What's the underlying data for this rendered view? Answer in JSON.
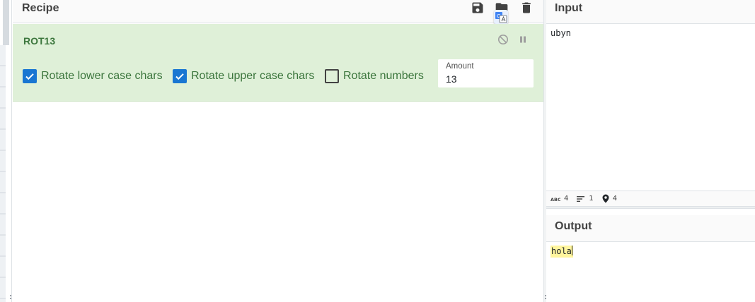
{
  "recipe": {
    "title": "Recipe",
    "icons": [
      "save-icon",
      "folder-open-icon",
      "trash-icon"
    ]
  },
  "operation": {
    "name": "ROT13",
    "controls": [
      "disable-icon",
      "pause-icon"
    ],
    "options": [
      {
        "label": "Rotate lower case chars",
        "checked": true
      },
      {
        "label": "Rotate upper case chars",
        "checked": true
      },
      {
        "label": "Rotate numbers",
        "checked": false
      }
    ],
    "amount": {
      "label": "Amount",
      "value": "13"
    }
  },
  "input": {
    "title": "Input",
    "text": "ubyn",
    "stats": {
      "length": "4",
      "lines": "1",
      "position": "4"
    }
  },
  "output": {
    "title": "Output",
    "text": "hola"
  },
  "colors": {
    "operation_bg": "#dff0d8",
    "operation_text": "#3c763d",
    "checkbox_accent": "#1976d2",
    "highlight": "#fff59d"
  }
}
